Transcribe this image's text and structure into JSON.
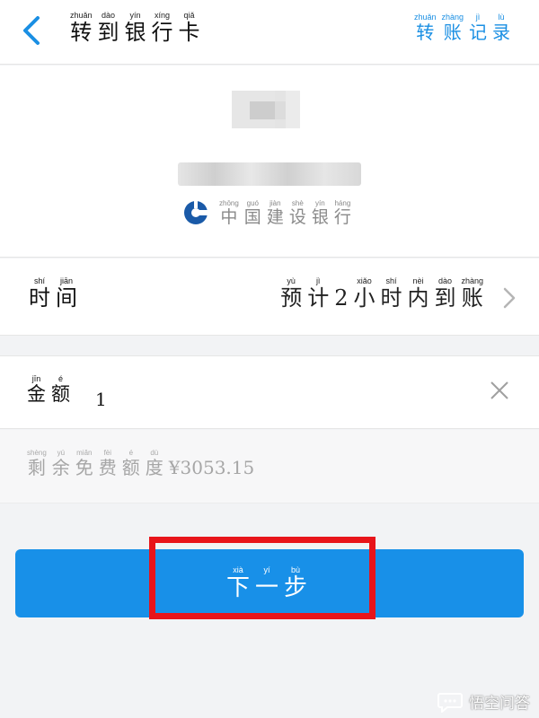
{
  "header": {
    "title": [
      {
        "p": "zhuǎn",
        "c": "转"
      },
      {
        "p": "dào",
        "c": "到"
      },
      {
        "p": "yín",
        "c": "银"
      },
      {
        "p": "xíng",
        "c": "行"
      },
      {
        "p": "qiǎ",
        "c": "卡"
      }
    ],
    "record_link": [
      {
        "p": "zhuǎn",
        "c": "转"
      },
      {
        "p": "zhàng",
        "c": "账"
      },
      {
        "p": "jì",
        "c": "记"
      },
      {
        "p": "lù",
        "c": "录"
      }
    ],
    "back_icon": "chevron-left-icon"
  },
  "account": {
    "bank_name": [
      {
        "p": "zhōng",
        "c": "中"
      },
      {
        "p": "guó",
        "c": "国"
      },
      {
        "p": "jiàn",
        "c": "建"
      },
      {
        "p": "shè",
        "c": "设"
      },
      {
        "p": "yín",
        "c": "银"
      },
      {
        "p": "háng",
        "c": "行"
      }
    ],
    "bank_logo_color": "#1a5aa8"
  },
  "time": {
    "label": [
      {
        "p": "shí",
        "c": "时"
      },
      {
        "p": "jiān",
        "c": "间"
      }
    ],
    "value": [
      {
        "p": "yù",
        "c": "预"
      },
      {
        "p": "jì",
        "c": "计"
      },
      {
        "p": "",
        "c": "2"
      },
      {
        "p": "xiǎo",
        "c": "小"
      },
      {
        "p": "shí",
        "c": "时"
      },
      {
        "p": "nèi",
        "c": "内"
      },
      {
        "p": "dào",
        "c": "到"
      },
      {
        "p": "zhàng",
        "c": "账"
      }
    ]
  },
  "amount": {
    "label": [
      {
        "p": "jīn",
        "c": "金"
      },
      {
        "p": "é",
        "c": "额"
      }
    ],
    "value": "1"
  },
  "quota": {
    "label": [
      {
        "p": "shèng",
        "c": "剩"
      },
      {
        "p": "yú",
        "c": "余"
      },
      {
        "p": "miǎn",
        "c": "免"
      },
      {
        "p": "fèi",
        "c": "费"
      },
      {
        "p": "é",
        "c": "额"
      },
      {
        "p": "dù",
        "c": "度"
      }
    ],
    "value": "¥3053.15"
  },
  "next_button": {
    "label": [
      {
        "p": "xià",
        "c": "下"
      },
      {
        "p": "yí",
        "c": "一"
      },
      {
        "p": "bù",
        "c": "步"
      }
    ]
  },
  "watermark": "悟空问答",
  "colors": {
    "accent": "#1890e8",
    "highlight": "#e8141a"
  }
}
